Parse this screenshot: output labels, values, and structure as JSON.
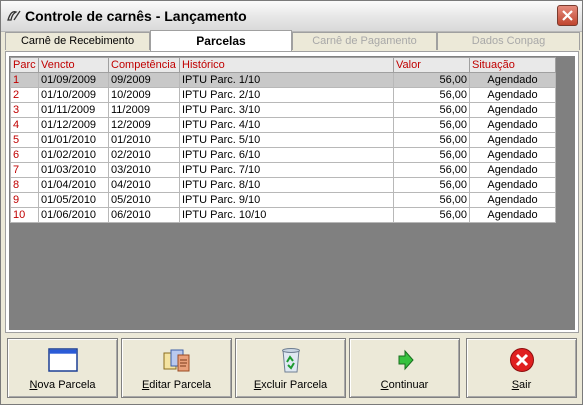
{
  "window": {
    "title": "Controle de carnês - Lançamento"
  },
  "tabs": [
    {
      "label": "Carnê de Recebimento",
      "state": "normal"
    },
    {
      "label": "Parcelas",
      "state": "active"
    },
    {
      "label": "Carnê de Pagamento",
      "state": "disabled"
    },
    {
      "label": "Dados Conpag",
      "state": "disabled"
    }
  ],
  "grid": {
    "columns": [
      "Parc",
      "Vencto",
      "Competência",
      "Histórico",
      "Valor",
      "Situação"
    ],
    "rows": [
      [
        "1",
        "01/09/2009",
        "09/2009",
        "IPTU Parc. 1/10",
        "56,00",
        "Agendado"
      ],
      [
        "2",
        "01/10/2009",
        "10/2009",
        "IPTU Parc. 2/10",
        "56,00",
        "Agendado"
      ],
      [
        "3",
        "01/11/2009",
        "11/2009",
        "IPTU Parc. 3/10",
        "56,00",
        "Agendado"
      ],
      [
        "4",
        "01/12/2009",
        "12/2009",
        "IPTU Parc. 4/10",
        "56,00",
        "Agendado"
      ],
      [
        "5",
        "01/01/2010",
        "01/2010",
        "IPTU Parc. 5/10",
        "56,00",
        "Agendado"
      ],
      [
        "6",
        "01/02/2010",
        "02/2010",
        "IPTU Parc. 6/10",
        "56,00",
        "Agendado"
      ],
      [
        "7",
        "01/03/2010",
        "03/2010",
        "IPTU Parc. 7/10",
        "56,00",
        "Agendado"
      ],
      [
        "8",
        "01/04/2010",
        "04/2010",
        "IPTU Parc. 8/10",
        "56,00",
        "Agendado"
      ],
      [
        "9",
        "01/05/2010",
        "05/2010",
        "IPTU Parc. 9/10",
        "56,00",
        "Agendado"
      ],
      [
        "10",
        "01/06/2010",
        "06/2010",
        "IPTU Parc. 10/10",
        "56,00",
        "Agendado"
      ]
    ],
    "selected_row": 0
  },
  "buttons": {
    "nova": {
      "accel": "N",
      "rest": "ova Parcela",
      "icon": "window-icon"
    },
    "editar": {
      "accel": "E",
      "rest": "ditar Parcela",
      "icon": "edit-documents-icon"
    },
    "excluir": {
      "accel": "E",
      "rest": "xcluir Parcela",
      "icon": "recycle-bin-icon"
    },
    "continuar": {
      "accel": "C",
      "rest": "ontinuar",
      "icon": "green-arrow-icon"
    },
    "sair": {
      "accel": "S",
      "rest": "air",
      "icon": "red-x-icon"
    }
  },
  "colors": {
    "header_text": "#c00000",
    "selected_row": "#c8c8c8",
    "grid_background": "#808080"
  }
}
